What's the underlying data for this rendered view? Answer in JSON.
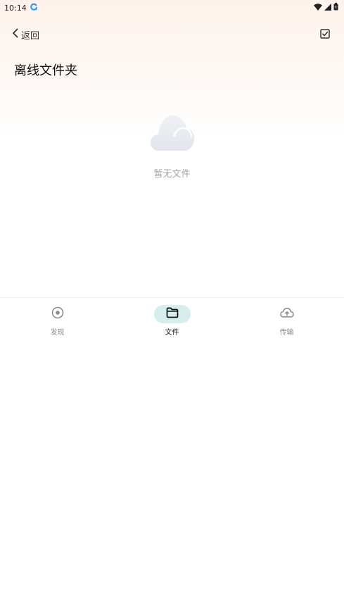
{
  "status_bar": {
    "time": "10:14",
    "icons": [
      "sync-icon",
      "wifi-icon",
      "signal-icon",
      "battery-icon"
    ]
  },
  "header": {
    "back_label": "返回",
    "back_icon": "chevron-left-icon",
    "select_icon": "checkbox-icon"
  },
  "page": {
    "title": "离线文件夹"
  },
  "empty_state": {
    "icon": "cloud-icon",
    "text": "暂无文件"
  },
  "bottom_nav": {
    "items": [
      {
        "label": "发现",
        "icon": "discover-icon",
        "active": false
      },
      {
        "label": "文件",
        "icon": "folder-icon",
        "active": true
      },
      {
        "label": "传输",
        "icon": "cloud-upload-icon",
        "active": false
      }
    ]
  },
  "colors": {
    "accent_pill": "#d7eeee",
    "sync_icon": "#2196f3",
    "header_gradient": "#fdf3ec",
    "muted_text": "#a4a8ae"
  }
}
